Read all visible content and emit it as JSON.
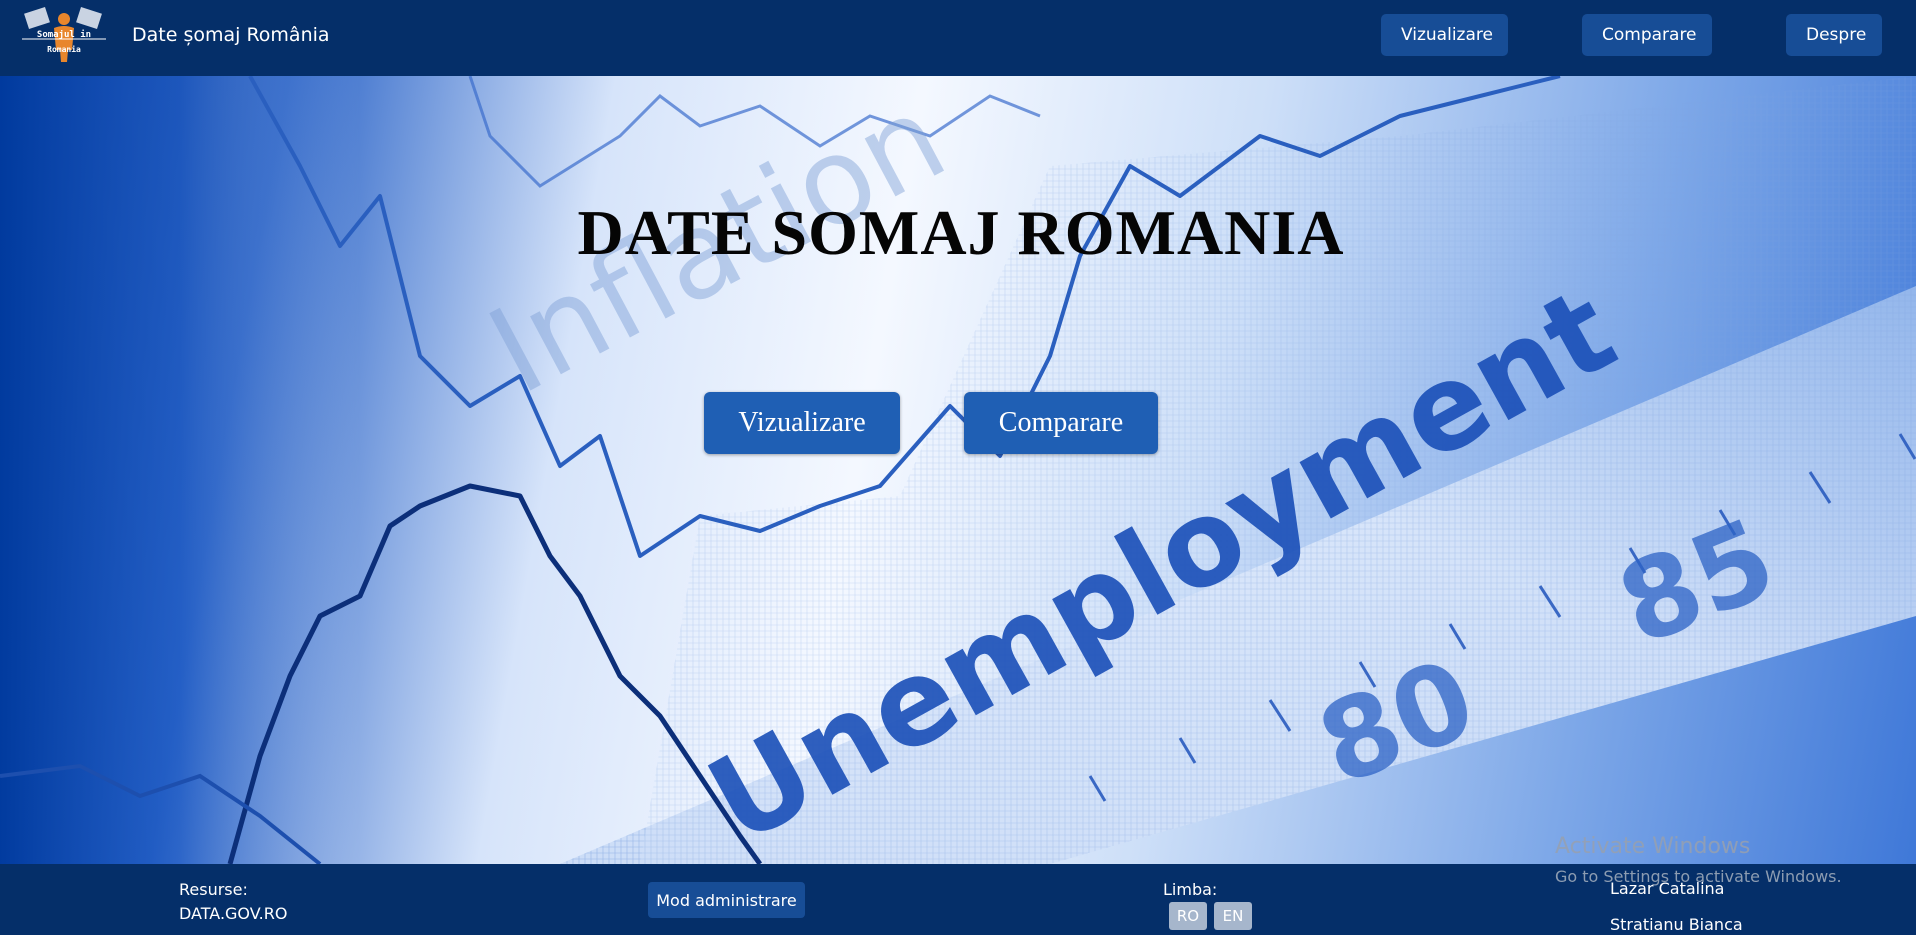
{
  "header": {
    "logo_text_line1": "Somajul in",
    "logo_text_line2": "Romania",
    "title": "Date șomaj România",
    "nav": {
      "vizualizare": "Vizualizare",
      "comparare": "Comparare",
      "despre": "Despre"
    }
  },
  "hero": {
    "title": "DATE SOMAJ ROMANIA",
    "buttons": {
      "vizualizare": "Vizualizare",
      "comparare": "Comparare"
    },
    "background_words": {
      "inflation": "Inflation",
      "unemployment": "Unemployment",
      "tick_80": "80",
      "tick_85": "85"
    }
  },
  "footer": {
    "resources_label": "Resurse:",
    "resources_link": "DATA.GOV.RO",
    "admin_button": "Mod administrare",
    "language_label": "Limba:",
    "languages": {
      "ro": "RO",
      "en": "EN"
    },
    "authors": [
      "Lazar Catalina",
      "Stratianu Bianca"
    ]
  },
  "os_watermark": {
    "title": "Activate Windows",
    "subtitle": "Go to Settings to activate Windows."
  },
  "colors": {
    "header_bg": "#052f69",
    "nav_button_bg": "#174d96",
    "hero_button_bg": "#1f5fb4",
    "language_button_bg": "#a6b6cc",
    "hero_title": "#050505"
  }
}
